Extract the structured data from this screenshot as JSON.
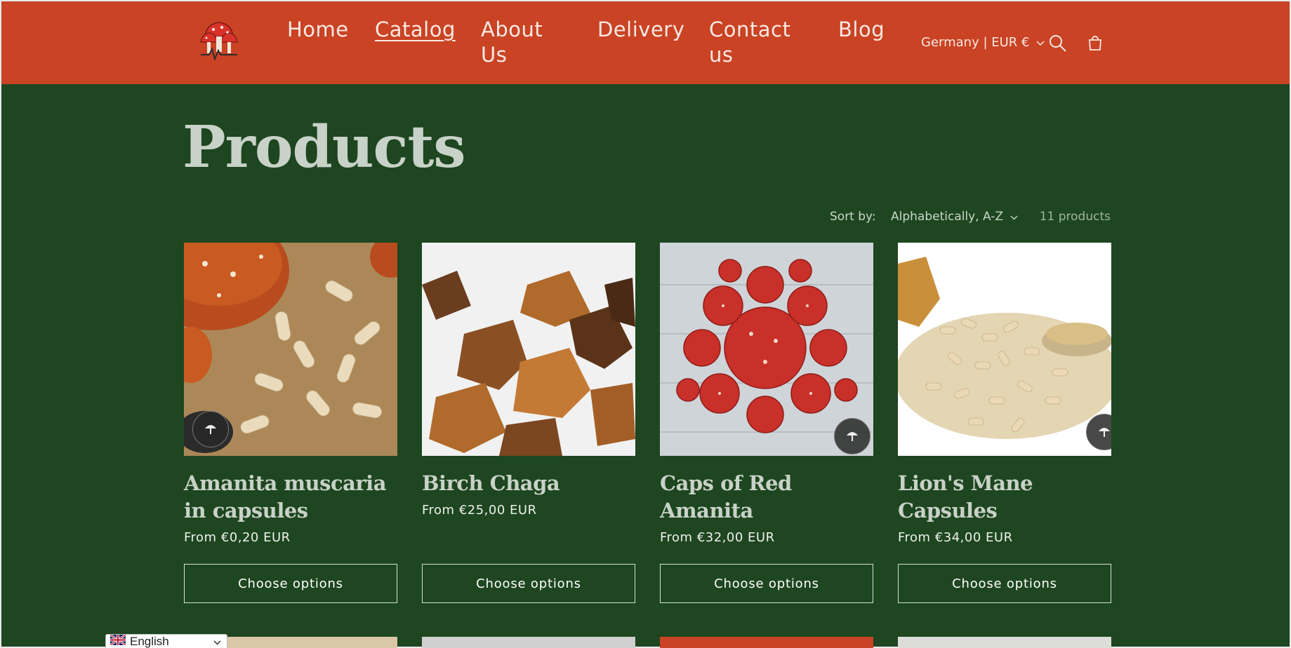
{
  "header": {
    "logo_name": "mushroom-logo",
    "nav": [
      {
        "label": "Home"
      },
      {
        "label": "Catalog"
      },
      {
        "label": "About Us"
      },
      {
        "label": "Delivery"
      },
      {
        "label": "Contact us"
      },
      {
        "label": "Blog"
      }
    ],
    "country": "Germany | EUR €",
    "accent": "#c94324"
  },
  "main": {
    "title": "Products",
    "sort_label": "Sort by:",
    "sort_value": "Alphabetically, A-Z",
    "count": "11 products",
    "background": "#1e4620",
    "products": [
      {
        "title": "Amanita muscaria in capsules",
        "price": "From €0,20 EUR",
        "button": "Choose options"
      },
      {
        "title": "Birch Chaga",
        "price": "From €25,00 EUR",
        "button": "Choose options"
      },
      {
        "title": "Caps of Red Amanita",
        "price": "From €32,00 EUR",
        "button": "Choose options"
      },
      {
        "title": "Lion's Mane Capsules",
        "price": "From €34,00 EUR",
        "button": "Choose options"
      }
    ]
  },
  "language": {
    "label": "English"
  }
}
